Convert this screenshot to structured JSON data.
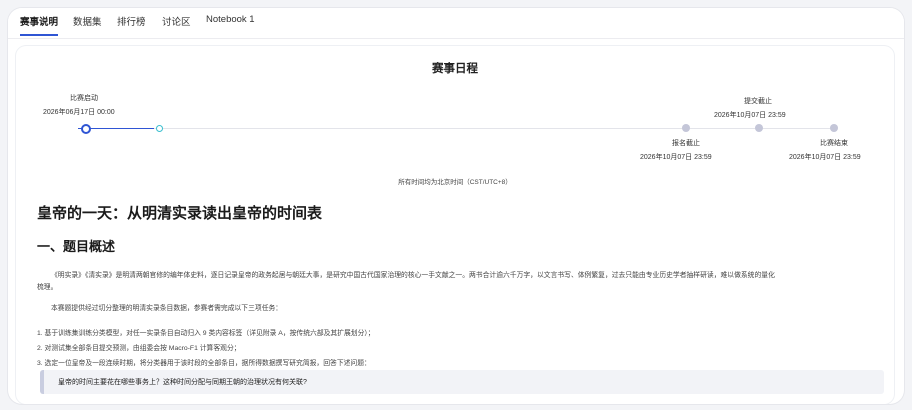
{
  "tabs": [
    {
      "label": "赛事说明",
      "active": true
    },
    {
      "label": "数据集",
      "active": false
    },
    {
      "label": "排行榜",
      "active": false
    },
    {
      "label": "讨论区",
      "active": false
    },
    {
      "label": "Notebook 1",
      "active": false
    }
  ],
  "schedule": {
    "title": "赛事日程",
    "milestones": [
      {
        "label": "比赛启动",
        "date": "2026年06月17日 00:00",
        "status": "current"
      },
      {
        "label": "",
        "date": "",
        "status": "next"
      },
      {
        "label": "报名截止",
        "date": "2026年10月07日 23:59",
        "status": "future"
      },
      {
        "label": "提交截止",
        "date": "2026年10月07日 23:59",
        "status": "future"
      },
      {
        "label": "比赛结束",
        "date": "2026年10月07日 23:59",
        "status": "future"
      }
    ],
    "timezone_note": "所有时间均为北京时间（CST/UTC+8）"
  },
  "content": {
    "title": "皇帝的一天：从明清实录读出皇帝的时间表",
    "section1_heading": "一、题目概述",
    "intro_line1": "《明实录》《清实录》是明清两朝官修的编年体史料，逐日记录皇帝的政务起居与朝廷大事，是研究中国古代国家治理的核心一手文献之一。两书合计逾六千万字，以文言书写、体例繁复，过去只能由专业历史学者抽样研读，难以做系统的量化",
    "intro_line2": "梳理。",
    "task_intro": "本赛题提供经过切分整理的明清实录条目数据，参赛者需完成以下三项任务：",
    "tasks": [
      "1. 基于训练集训练分类模型，对任一实录条目自动归入 9 类内容标签（详见附录 A，按传统六部及其扩展划分）；",
      "2. 对测试集全部条目提交预测，由组委会按 Macro-F1 计算客观分；",
      "3. 选定一位皇帝及一段连续时期，将分类器用于该时段的全部条目，据所得数据撰写研究简报，回答下述问题："
    ],
    "question": "皇帝的时间主要花在哪些事务上？这种时间分配与同期王朝的治理状况有何关联?"
  },
  "colors": {
    "accent": "#2f55d4",
    "teal": "#3bbfcf",
    "future_dot": "#c4c6d8",
    "line": "#e3e4ea"
  }
}
